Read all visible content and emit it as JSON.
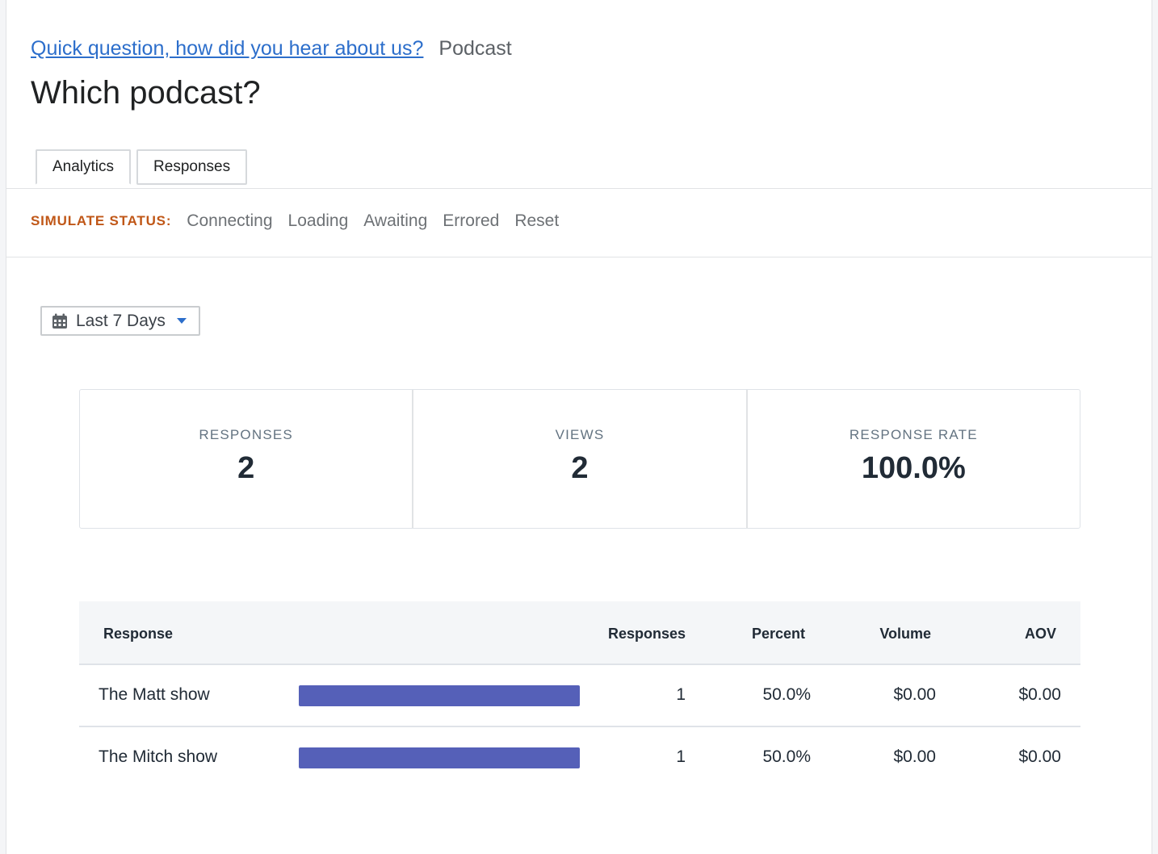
{
  "header": {
    "breadcrumb_link": "Quick question, how did you hear about us?",
    "breadcrumb_current": "Podcast",
    "title": "Which podcast?"
  },
  "tabs": [
    {
      "label": "Analytics",
      "active": true
    },
    {
      "label": "Responses",
      "active": false
    }
  ],
  "simulate": {
    "label": "SIMULATE STATUS:",
    "options": [
      "Connecting",
      "Loading",
      "Awaiting",
      "Errored",
      "Reset"
    ]
  },
  "date_filter": {
    "label": "Last 7 Days",
    "icon": "calendar-icon"
  },
  "stats": [
    {
      "label": "RESPONSES",
      "value": "2"
    },
    {
      "label": "VIEWS",
      "value": "2"
    },
    {
      "label": "RESPONSE RATE",
      "value": "100.0%"
    }
  ],
  "table": {
    "headers": {
      "response": "Response",
      "responses": "Responses",
      "percent": "Percent",
      "volume": "Volume",
      "aov": "AOV"
    },
    "rows": [
      {
        "response": "The Matt show",
        "share": 1.0,
        "responses": "1",
        "percent": "50.0%",
        "volume": "$0.00",
        "aov": "$0.00"
      },
      {
        "response": "The Mitch show",
        "share": 1.0,
        "responses": "1",
        "percent": "50.0%",
        "volume": "$0.00",
        "aov": "$0.00"
      }
    ]
  },
  "colors": {
    "link": "#2c6ecb",
    "bar": "#5560b8",
    "sim_label": "#c05717"
  }
}
